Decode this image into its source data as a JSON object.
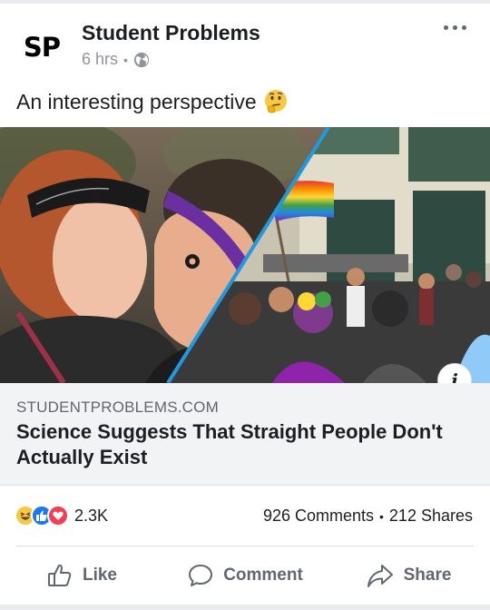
{
  "post": {
    "page_name": "Student Problems",
    "page_logo": "SP",
    "time": "6 hrs",
    "privacy_icon": "globe-icon",
    "caption": "An interesting perspective",
    "caption_emoji": "thinking-face-emoji"
  },
  "link": {
    "domain": "STUDENTPROBLEMS.COM",
    "title": "Science Suggests That Straight People Don't Actually Exist",
    "info_icon": "info-icon"
  },
  "stats": {
    "reaction_count": "2.3K",
    "comments": "926 Comments",
    "shares": "212 Shares"
  },
  "actions": {
    "like": "Like",
    "comment": "Comment",
    "share": "Share"
  },
  "colors": {
    "accent": "#1877f2",
    "secondary_text": "#606770",
    "card_background": "#f2f3f5",
    "love": "#f33e58",
    "haha": "#f7c943"
  }
}
